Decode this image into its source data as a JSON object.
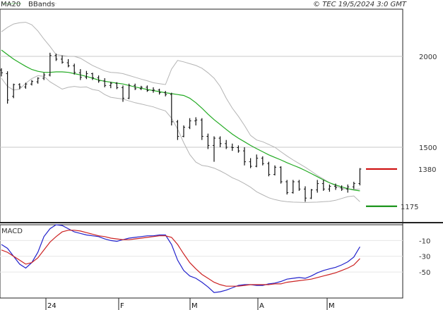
{
  "header": {
    "legend_items": [
      {
        "label": "MA20",
        "color": "#22aa22"
      },
      {
        "label": "BBands",
        "color": "#aaaaaa"
      }
    ],
    "copyright": "© TEC 19/5/2024 3:0 GMT"
  },
  "macd_panel": {
    "title": "MACD"
  },
  "colors": {
    "price_bars": "#111111",
    "ma20": "#22aa22",
    "bbands": "#b4b4b4",
    "macd_line": "#2222cc",
    "signal_line": "#cc2222",
    "resistance": "#cc0000",
    "support": "#008800",
    "grid": "#c8c8c8"
  },
  "chart_data": [
    {
      "type": "line",
      "title": "",
      "price_axis": {
        "ticks": [
          2000,
          1500
        ],
        "ylim": [
          1085,
          2260
        ]
      },
      "x_axis": {
        "ticks": [
          "24",
          "F",
          "M",
          "A",
          "M"
        ]
      },
      "levels": [
        {
          "label": "1380",
          "value": 1380,
          "color": "#cc0000"
        },
        {
          "label": "1175",
          "value": 1175,
          "color": "#008800"
        }
      ],
      "series": [
        {
          "name": "MA20",
          "values": [
            2035,
            2010,
            1985,
            1965,
            1945,
            1928,
            1918,
            1912,
            1912,
            1915,
            1915,
            1912,
            1905,
            1898,
            1890,
            1880,
            1870,
            1863,
            1858,
            1853,
            1848,
            1840,
            1832,
            1825,
            1818,
            1812,
            1806,
            1800,
            1795,
            1790,
            1785,
            1770,
            1745,
            1715,
            1682,
            1652,
            1625,
            1598,
            1572,
            1550,
            1530,
            1510,
            1492,
            1475,
            1458,
            1444,
            1430,
            1415,
            1401,
            1388,
            1372,
            1355,
            1338,
            1320,
            1304,
            1292,
            1282,
            1272,
            1265,
            1260
          ]
        },
        {
          "name": "BBands upper",
          "values": [
            2135,
            2160,
            2178,
            2185,
            2188,
            2174,
            2140,
            2095,
            2055,
            2010,
            2005,
            2000,
            2000,
            1990,
            1970,
            1950,
            1935,
            1920,
            1912,
            1910,
            1905,
            1895,
            1885,
            1875,
            1866,
            1855,
            1850,
            1845,
            1930,
            1978,
            1970,
            1960,
            1950,
            1935,
            1910,
            1880,
            1835,
            1770,
            1715,
            1670,
            1620,
            1565,
            1540,
            1530,
            1515,
            1500,
            1475,
            1452,
            1430,
            1410,
            1390,
            1368,
            1345,
            1325,
            1305,
            1288,
            1272,
            1270,
            1268,
            1270
          ]
        },
        {
          "name": "BBands lower",
          "values": [
            1880,
            1835,
            1815,
            1820,
            1852,
            1878,
            1894,
            1890,
            1860,
            1840,
            1820,
            1830,
            1835,
            1830,
            1832,
            1818,
            1812,
            1790,
            1775,
            1770,
            1765,
            1755,
            1745,
            1738,
            1730,
            1722,
            1710,
            1700,
            1660,
            1600,
            1525,
            1460,
            1418,
            1400,
            1395,
            1385,
            1370,
            1352,
            1332,
            1318,
            1300,
            1280,
            1255,
            1238,
            1222,
            1212,
            1205,
            1200,
            1198,
            1197,
            1196,
            1197,
            1198,
            1200,
            1202,
            1208,
            1218,
            1228,
            1232,
            1200
          ]
        }
      ],
      "ohlc": [
        [
          1925,
          1935,
          1890,
          1910
        ],
        [
          1905,
          1918,
          1740,
          1760
        ],
        [
          1780,
          1850,
          1770,
          1845
        ],
        [
          1845,
          1852,
          1820,
          1832
        ],
        [
          1832,
          1855,
          1822,
          1848
        ],
        [
          1848,
          1870,
          1840,
          1862
        ],
        [
          1860,
          1885,
          1850,
          1880
        ],
        [
          1880,
          1910,
          1870,
          1898
        ],
        [
          1898,
          2020,
          1890,
          2005
        ],
        [
          2005,
          2015,
          1975,
          1985
        ],
        [
          1985,
          2005,
          1960,
          1968
        ],
        [
          1965,
          1985,
          1940,
          1948
        ],
        [
          1948,
          1960,
          1900,
          1912
        ],
        [
          1910,
          1930,
          1870,
          1885
        ],
        [
          1885,
          1920,
          1875,
          1905
        ],
        [
          1905,
          1910,
          1870,
          1882
        ],
        [
          1882,
          1895,
          1855,
          1865
        ],
        [
          1865,
          1880,
          1830,
          1840
        ],
        [
          1840,
          1860,
          1825,
          1852
        ],
        [
          1852,
          1858,
          1820,
          1828
        ],
        [
          1828,
          1840,
          1750,
          1770
        ],
        [
          1770,
          1850,
          1765,
          1840
        ],
        [
          1840,
          1850,
          1815,
          1822
        ],
        [
          1822,
          1838,
          1815,
          1830
        ],
        [
          1830,
          1840,
          1805,
          1812
        ],
        [
          1812,
          1830,
          1800,
          1815
        ],
        [
          1815,
          1822,
          1790,
          1800
        ],
        [
          1800,
          1810,
          1780,
          1790
        ],
        [
          1790,
          1800,
          1620,
          1640
        ],
        [
          1640,
          1650,
          1540,
          1560
        ],
        [
          1560,
          1620,
          1555,
          1610
        ],
        [
          1610,
          1660,
          1600,
          1645
        ],
        [
          1645,
          1665,
          1620,
          1650
        ],
        [
          1650,
          1660,
          1540,
          1560
        ],
        [
          1560,
          1575,
          1490,
          1510
        ],
        [
          1510,
          1560,
          1420,
          1550
        ],
        [
          1550,
          1560,
          1500,
          1520
        ],
        [
          1520,
          1540,
          1490,
          1500
        ],
        [
          1500,
          1520,
          1480,
          1498
        ],
        [
          1498,
          1510,
          1470,
          1480
        ],
        [
          1480,
          1500,
          1400,
          1420
        ],
        [
          1420,
          1440,
          1385,
          1395
        ],
        [
          1395,
          1460,
          1390,
          1440
        ],
        [
          1440,
          1450,
          1400,
          1410
        ],
        [
          1410,
          1420,
          1340,
          1350
        ],
        [
          1350,
          1400,
          1345,
          1390
        ],
        [
          1390,
          1395,
          1300,
          1310
        ],
        [
          1310,
          1320,
          1240,
          1250
        ],
        [
          1250,
          1320,
          1245,
          1310
        ],
        [
          1310,
          1320,
          1260,
          1270
        ],
        [
          1270,
          1285,
          1200,
          1220
        ],
        [
          1220,
          1270,
          1215,
          1265
        ],
        [
          1265,
          1320,
          1250,
          1300
        ],
        [
          1300,
          1320,
          1260,
          1270
        ],
        [
          1270,
          1295,
          1255,
          1285
        ],
        [
          1285,
          1300,
          1265,
          1278
        ],
        [
          1278,
          1290,
          1260,
          1270
        ],
        [
          1270,
          1295,
          1250,
          1282
        ],
        [
          1282,
          1310,
          1270,
          1300
        ],
        [
          1300,
          1385,
          1290,
          1380
        ]
      ]
    },
    {
      "type": "line",
      "title": "MACD",
      "y_axis": {
        "ticks": [
          -10,
          -30,
          -50
        ],
        "ylim": [
          -83,
          10
        ]
      },
      "series": [
        {
          "name": "MACD",
          "values": [
            -15,
            -20,
            -30,
            -40,
            -45,
            -38,
            -25,
            -5,
            5,
            10,
            9,
            5,
            1,
            -1,
            -3,
            -4,
            -5,
            -8,
            -10,
            -11,
            -9,
            -7,
            -6,
            -5,
            -4,
            -4,
            -3,
            -3,
            -15,
            -35,
            -48,
            -55,
            -58,
            -63,
            -69,
            -76,
            -75,
            -73,
            -70,
            -67,
            -66,
            -66,
            -67,
            -67,
            -65,
            -64,
            -62,
            -59,
            -58,
            -57,
            -58,
            -55,
            -51,
            -48,
            -46,
            -44,
            -41,
            -37,
            -31,
            -18
          ]
        },
        {
          "name": "Signal",
          "values": [
            -22,
            -25,
            -30,
            -35,
            -40,
            -38,
            -32,
            -22,
            -12,
            -5,
            1,
            3,
            3,
            2,
            0,
            -2,
            -4,
            -5,
            -7,
            -8,
            -9,
            -9,
            -8,
            -7,
            -6,
            -5,
            -4,
            -4,
            -6,
            -15,
            -27,
            -38,
            -46,
            -53,
            -58,
            -63,
            -66,
            -68,
            -68,
            -68,
            -67,
            -66,
            -66,
            -66,
            -66,
            -65,
            -65,
            -63,
            -62,
            -61,
            -60,
            -59,
            -57,
            -55,
            -53,
            -51,
            -48,
            -45,
            -41,
            -33
          ]
        }
      ]
    }
  ]
}
